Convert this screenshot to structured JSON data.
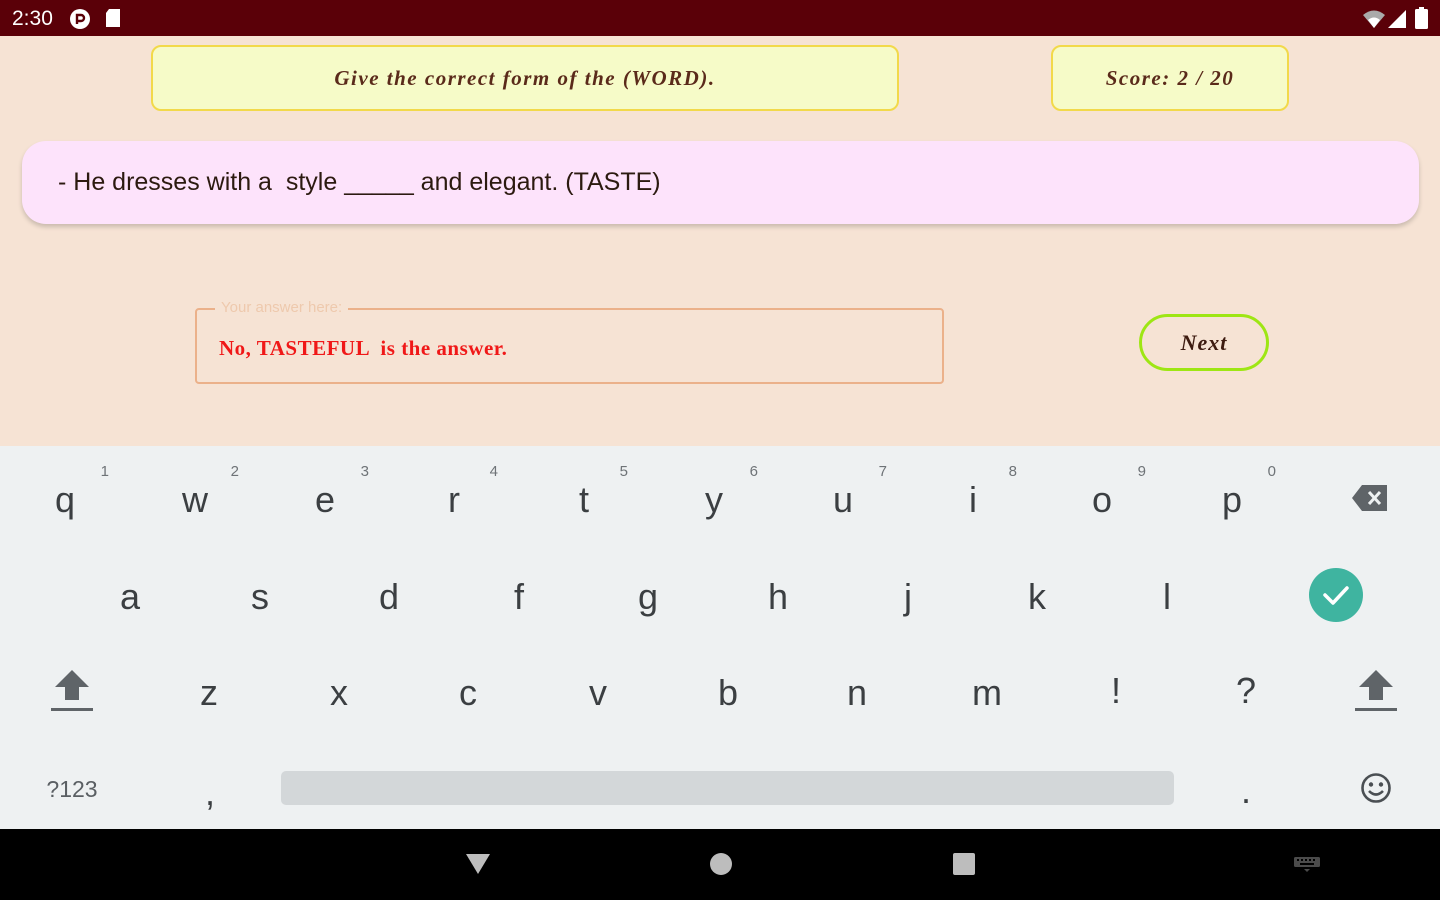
{
  "status_bar": {
    "time": "2:30",
    "icons": [
      "pocket-casts-icon",
      "sd-card-icon",
      "wifi-icon",
      "cell-signal-icon",
      "battery-icon"
    ],
    "background": "#5a0008"
  },
  "header": {
    "instruction": "Give the correct form of the (WORD).",
    "score": "Score: 2 / 20"
  },
  "question": {
    "text": "- He dresses with a  style _____ and elegant. (TASTE)"
  },
  "answer_field": {
    "label": "Your answer here:",
    "value": "No, TASTEFUL  is the answer."
  },
  "next_button": {
    "label": "Next"
  },
  "keyboard": {
    "row1": [
      {
        "key": "q",
        "hint": "1"
      },
      {
        "key": "w",
        "hint": "2"
      },
      {
        "key": "e",
        "hint": "3"
      },
      {
        "key": "r",
        "hint": "4"
      },
      {
        "key": "t",
        "hint": "5"
      },
      {
        "key": "y",
        "hint": "6"
      },
      {
        "key": "u",
        "hint": "7"
      },
      {
        "key": "i",
        "hint": "8"
      },
      {
        "key": "o",
        "hint": "9"
      },
      {
        "key": "p",
        "hint": "0"
      }
    ],
    "row2": [
      "a",
      "s",
      "d",
      "f",
      "g",
      "h",
      "j",
      "k",
      "l"
    ],
    "row3": [
      "z",
      "x",
      "c",
      "v",
      "b",
      "n",
      "m",
      "!",
      "?"
    ],
    "symbols_key": "?123",
    "comma_key": ",",
    "period_key": ".",
    "enter_color": "#3fb4a0"
  },
  "colors": {
    "page_bg": "#f6e3d4",
    "header_box_bg": "#f6fbc8",
    "header_box_border": "#f2d94a",
    "question_bg": "#fde3fb",
    "answer_border": "#ebb18a",
    "answer_text": "#f01818",
    "next_border": "#9ee614"
  }
}
